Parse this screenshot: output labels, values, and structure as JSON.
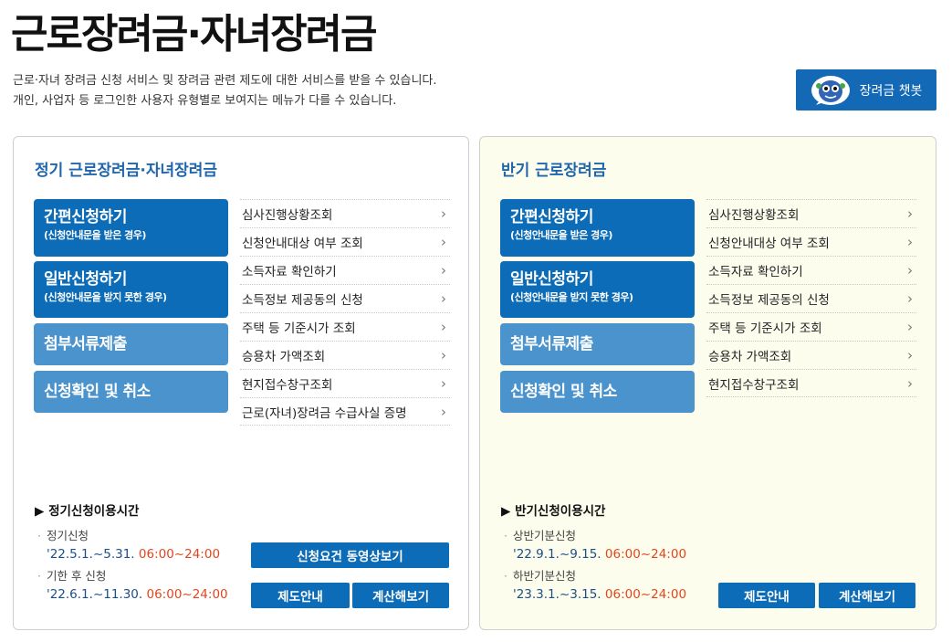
{
  "header": {
    "title": "근로장려금·자녀장려금",
    "desc_line1": "근로·자녀 장려금 신청 서비스 및 장려금 관련 제도에 대한 서비스를 받을 수 있습니다.",
    "desc_line2": "개인, 사업자 등 로그인한 사용자 유형별로 보여지는 메뉴가 다를 수 있습니다.",
    "chatbot_label": "장려금 챗봇"
  },
  "left": {
    "title": "정기 근로장려금·자녀장려금",
    "btn_easy_main": "간편신청하기",
    "btn_easy_sub": "(신청안내문을 받은 경우)",
    "btn_general_main": "일반신청하기",
    "btn_general_sub": "(신청안내문을 받지 못한 경우)",
    "btn_docs": "첨부서류제출",
    "btn_confirm": "신청확인 및 취소",
    "links": [
      "심사진행상황조회",
      "신청안내대상 여부 조회",
      "소득자료 확인하기",
      "소득정보 제공동의 신청",
      "주택 등 기준시가 조회",
      "승용차 가액조회",
      "현지접수창구조회",
      "근로(자녀)장려금 수급사실 증명"
    ],
    "usage_title": "정기신청이용시간",
    "usage": [
      {
        "label": "정기신청",
        "range": "'22.5.1.~5.31.",
        "time": "06:00~24:00"
      },
      {
        "label": "기한 후 신청",
        "range": "'22.6.1.~11.30.",
        "time": "06:00~24:00"
      }
    ],
    "btn_video": "신청요건 동영상보기",
    "btn_guide": "제도안내",
    "btn_calc": "계산해보기"
  },
  "right": {
    "title": "반기 근로장려금",
    "btn_easy_main": "간편신청하기",
    "btn_easy_sub": "(신청안내문을 받은 경우)",
    "btn_general_main": "일반신청하기",
    "btn_general_sub": "(신청안내문을 받지 못한 경우)",
    "btn_docs": "첨부서류제출",
    "btn_confirm": "신청확인 및 취소",
    "links": [
      "심사진행상황조회",
      "신청안내대상 여부 조회",
      "소득자료 확인하기",
      "소득정보 제공동의 신청",
      "주택 등 기준시가 조회",
      "승용차 가액조회",
      "현지접수창구조회"
    ],
    "usage_title": "반기신청이용시간",
    "usage": [
      {
        "label": "상반기분신청",
        "range": "'22.9.1.~9.15.",
        "time": "06:00~24:00"
      },
      {
        "label": "하반기분신청",
        "range": "'23.3.1.~3.15.",
        "time": "06:00~24:00"
      }
    ],
    "btn_guide": "제도안내",
    "btn_calc": "계산해보기"
  },
  "colors": {
    "primary": "#0c6cb7",
    "secondary": "#4a93cd",
    "title_blue": "#1f66ad",
    "time_red": "#e3451c",
    "right_bg": "#fdfdee"
  },
  "icons": {
    "chatbot": "chatbot-mascot-icon",
    "arrow": "chevron-right-icon",
    "bullet": "triangle-right-icon"
  }
}
